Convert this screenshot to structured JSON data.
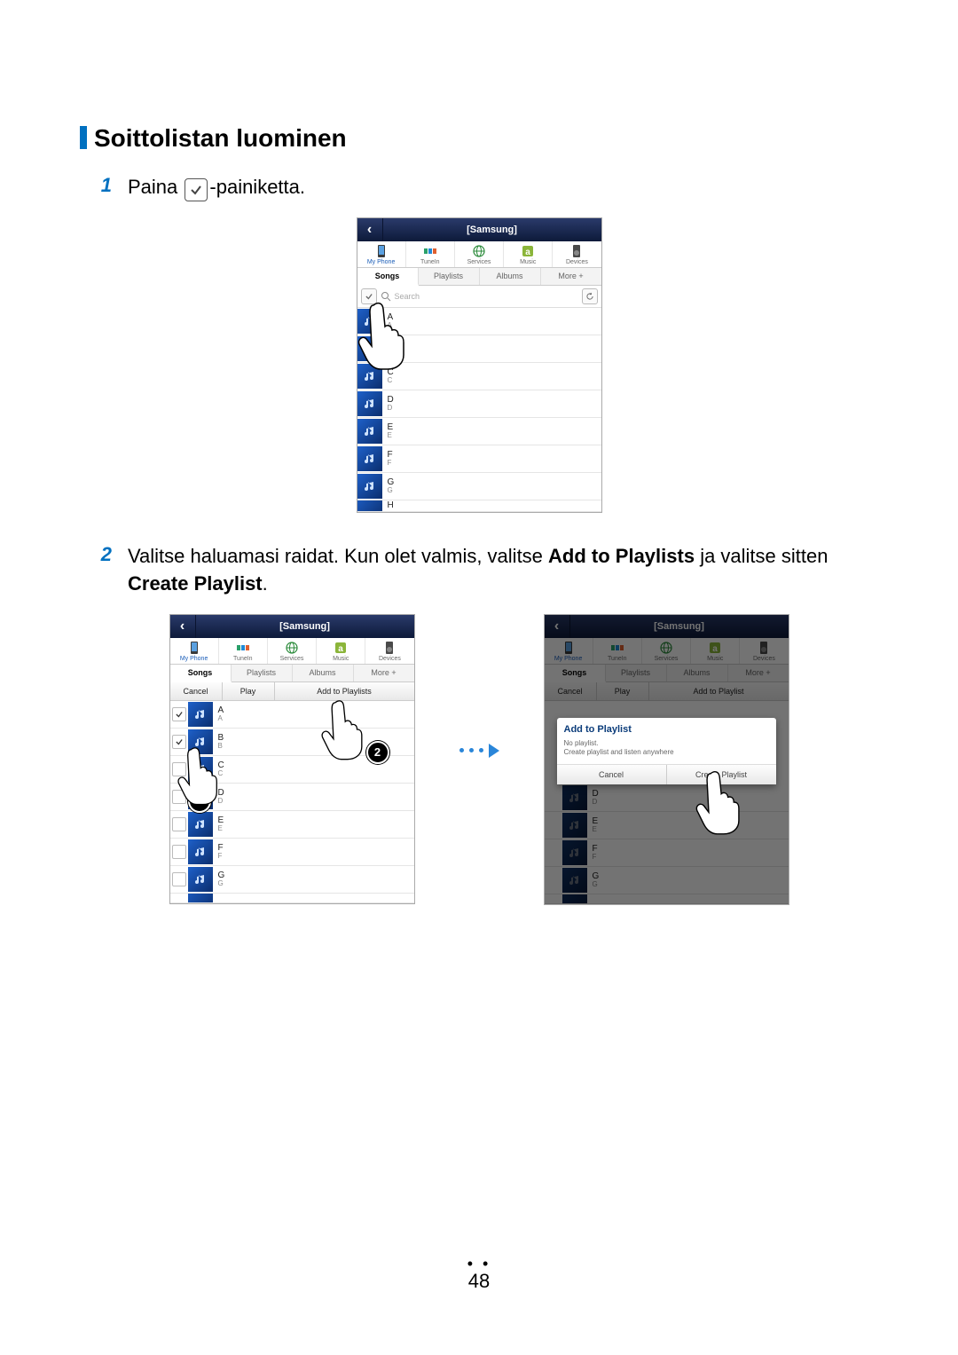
{
  "section_title": "Soittolistan luominen",
  "steps": {
    "1": {
      "num": "1",
      "text_before": "Paina ",
      "text_after": "-painiketta."
    },
    "2": {
      "num": "2",
      "text_plain1": "Valitse haluamasi raidat. Kun olet valmis, valitse ",
      "bold1": "Add to Playlists",
      "text_plain2": " ja valitse sitten ",
      "bold2": "Create Playlist",
      "text_plain3": "."
    }
  },
  "phone_common": {
    "header_title": "[Samsung]",
    "sources": {
      "my_phone": "My Phone",
      "tunein": "TuneIn",
      "services": "Services",
      "music": "Music",
      "devices": "Devices"
    },
    "views": {
      "songs": "Songs",
      "playlists": "Playlists",
      "albums": "Albums",
      "more": "More +"
    },
    "search_placeholder": "Search",
    "actions": {
      "cancel": "Cancel",
      "play": "Play",
      "add_to_playlists": "Add to Playlists",
      "add_to_playlist": "Add to Playlist"
    }
  },
  "songs_short": [
    {
      "t": "A",
      "s": "A"
    },
    {
      "t": "C",
      "s": "C"
    },
    {
      "t": "D",
      "s": "D"
    },
    {
      "t": "E",
      "s": "E"
    },
    {
      "t": "F",
      "s": "F"
    },
    {
      "t": "G",
      "s": "G"
    },
    {
      "t": "H",
      "s": ""
    }
  ],
  "songs_select": [
    {
      "t": "A",
      "s": "A",
      "checked": true
    },
    {
      "t": "B",
      "s": "B",
      "checked": true
    },
    {
      "t": "C",
      "s": "C",
      "checked": false
    },
    {
      "t": "D",
      "s": "D",
      "checked": false
    },
    {
      "t": "E",
      "s": "E",
      "checked": false
    },
    {
      "t": "F",
      "s": "F",
      "checked": false
    },
    {
      "t": "G",
      "s": "G",
      "checked": false
    }
  ],
  "songs_dim": [
    {
      "t": "D",
      "s": "D"
    },
    {
      "t": "E",
      "s": "E"
    },
    {
      "t": "F",
      "s": "F"
    },
    {
      "t": "G",
      "s": "G"
    }
  ],
  "popup": {
    "title": "Add to Playlist",
    "body1": "No playlist.",
    "body2": "Create playlist and listen anywhere",
    "cancel": "Cancel",
    "create": "Create Playlist"
  },
  "callouts": {
    "one": "1",
    "two": "2"
  },
  "page_number": "48"
}
